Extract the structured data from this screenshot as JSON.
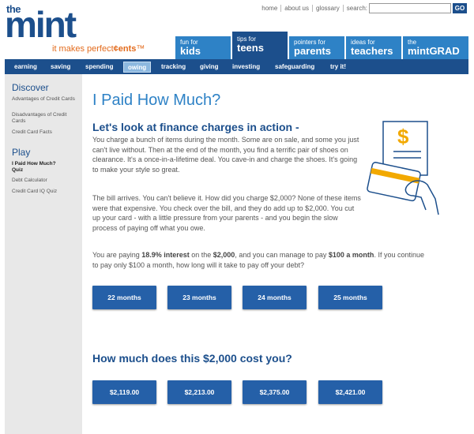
{
  "logo": {
    "the": "the",
    "mint": "mint",
    "tag_prefix": "it makes perfect",
    "tag_bold": "¢ents",
    "tag_suffix": "™"
  },
  "toplinks": {
    "home": "home",
    "about": "about us",
    "glossary": "glossary",
    "search": "search:"
  },
  "search": {
    "placeholder": "",
    "go": "GO"
  },
  "audience_tabs": [
    {
      "small": "fun for",
      "big": "kids"
    },
    {
      "small": "tips for",
      "big": "teens"
    },
    {
      "small": "pointers for",
      "big": "parents"
    },
    {
      "small": "ideas for",
      "big": "teachers"
    },
    {
      "small": "the",
      "big": "mintGRAD"
    }
  ],
  "nav": [
    "earning",
    "saving",
    "spending",
    "owing",
    "tracking",
    "giving",
    "investing",
    "safeguarding",
    "try it!"
  ],
  "sidebar": {
    "discover_heading": "Discover",
    "discover_links": [
      "Advantages of Credit Cards",
      "Disadvantages of Credit Cards",
      "Credit Card Facts"
    ],
    "play_heading": "Play",
    "play_links": [
      "I Paid How Much? Quiz",
      "Debt Calculator",
      "Credit Card IQ Quiz"
    ]
  },
  "main": {
    "title": "I Paid How Much?",
    "heading": "Let's look at finance charges in action -",
    "para1": "You charge a bunch of items during the month. Some are on sale, and some you just can't live without. Then at the end of the month, you find a terrific pair of shoes on clearance. It's a once-in-a-lifetime deal. You cave-in and charge the shoes. It's going to make your style so great.",
    "para2": "The bill arrives. You can't believe it. How did you charge $2,000? None of these items were that expensive. You check over the bill, and they do add up to $2,000. You cut up your card - with a little pressure from your parents - and you begin the slow process of paying off what you owe.",
    "para3_a": "You are paying ",
    "para3_b": "18.9% interest",
    "para3_c": " on the ",
    "para3_d": "$2,000",
    "para3_e": ", and you can manage to pay ",
    "para3_f": "$100 a month",
    "para3_g": ". If you continue to pay only $100 a month, how long will it take to pay off your debt?",
    "month_buttons": [
      "22 months",
      "23 months",
      "24 months",
      "25 months"
    ],
    "heading2": "How much does this $2,000 cost you?",
    "cost_buttons": [
      "$2,119.00",
      "$2,213.00",
      "$2,375.00",
      "$2,421.00"
    ]
  },
  "colors": {
    "brand_blue": "#1c4f8c",
    "tab_blue": "#2e82c6",
    "button_blue": "#2560a8",
    "accent_orange": "#e36b1c",
    "sidebar_bg": "#e8e8e8"
  }
}
